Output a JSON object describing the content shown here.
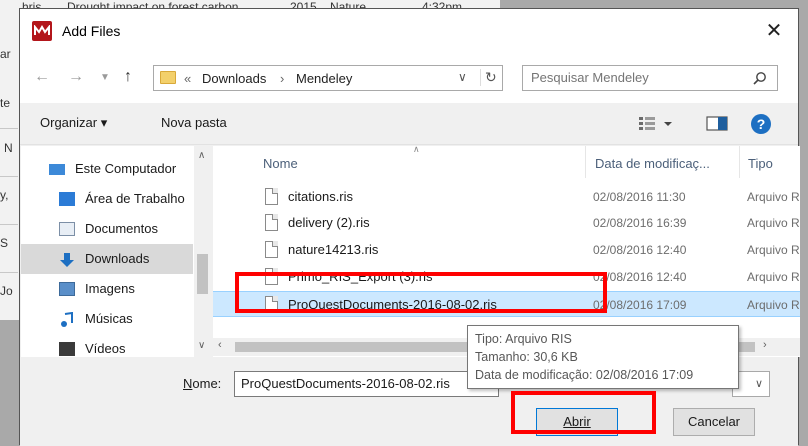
{
  "background": {
    "rows": [
      {
        "a": "hris",
        "b": "Drought impact on forest carbon...",
        "c": "2015",
        "d": "Nature",
        "e": "4:32pm"
      }
    ],
    "side_letters": [
      "ar",
      "te",
      "N",
      "y,",
      "S",
      "Jo"
    ]
  },
  "dialog": {
    "title": "Add Files",
    "close_glyph": "✕"
  },
  "address": {
    "prefix": "«",
    "crumbs": [
      "Downloads",
      "›",
      "Mendeley"
    ],
    "search_placeholder": "Pesquisar Mendeley"
  },
  "toolbar": {
    "organize": "Organizar ▾",
    "new_folder": "Nova pasta"
  },
  "nav_pane": {
    "items": [
      {
        "label": "Este Computador",
        "icon": "computer-icon"
      },
      {
        "label": "Área de Trabalho",
        "icon": "desktop-icon"
      },
      {
        "label": "Documentos",
        "icon": "documents-icon"
      },
      {
        "label": "Downloads",
        "icon": "downloads-icon",
        "selected": true
      },
      {
        "label": "Imagens",
        "icon": "pictures-icon"
      },
      {
        "label": "Músicas",
        "icon": "music-icon"
      },
      {
        "label": "Vídeos",
        "icon": "videos-icon"
      }
    ]
  },
  "file_list": {
    "columns": [
      "Nome",
      "Data de modificaç...",
      "Tipo"
    ],
    "rows": [
      {
        "name": "citations.ris",
        "date": "02/08/2016 11:30",
        "type": "Arquivo R"
      },
      {
        "name": "delivery (2).ris",
        "date": "02/08/2016 16:39",
        "type": "Arquivo R"
      },
      {
        "name": "nature14213.ris",
        "date": "02/08/2016 12:40",
        "type": "Arquivo R"
      },
      {
        "name": "Primo_RIS_Export (3).ris",
        "date": "02/08/2016 12:40",
        "type": "Arquivo R"
      },
      {
        "name": "ProQuestDocuments-2016-08-02.ris",
        "date": "02/08/2016 17:09",
        "type": "Arquivo R",
        "selected": true
      }
    ]
  },
  "tooltip": {
    "type": "Tipo: Arquivo RIS",
    "size": "Tamanho: 30,6 KB",
    "modified": "Data de modificação: 02/08/2016 17:09"
  },
  "bottom": {
    "name_label_prefix": "N",
    "name_label_rest": "ome:",
    "filename_value": "ProQuestDocuments-2016-08-02.ris",
    "open_label": "Abrir",
    "cancel_label": "Cancelar"
  },
  "colors": {
    "highlight": "#ff0000",
    "selection": "#cce8ff",
    "accent": "#0078d7",
    "app_icon": "#b3161b"
  }
}
